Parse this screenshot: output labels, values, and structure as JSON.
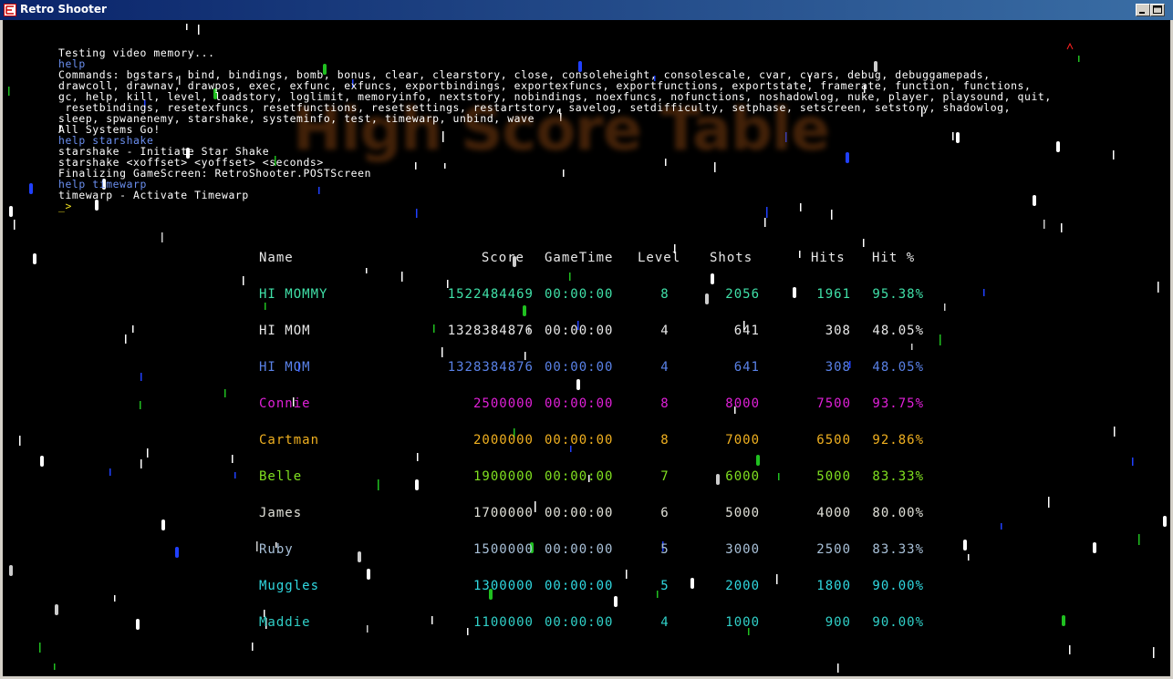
{
  "window": {
    "title": "Retro Shooter"
  },
  "background_title": "High Score Table",
  "console": {
    "lines": [
      {
        "text": "Testing video memory...",
        "kind": "out"
      },
      {
        "text": "help",
        "kind": "cmd"
      },
      {
        "text": "Commands: bgstars, bind, bindings, bomb, bonus, clear, clearstory, close, consoleheight, consolescale, cvar, cvars, debug, debuggamepads,",
        "kind": "out"
      },
      {
        "text": "drawcoll, drawnav, drawpos, exec, exfunc, exfuncs, exportbindings, exportexfuncs, exportfunctions, exportstate, framerate, function, functions,",
        "kind": "out"
      },
      {
        "text": "gc, help, kill, level, loadstory, loglimit, memoryinfo, nextstory, nobindings, noexfuncs, nofunctions, noshadowlog, nuke, player, playsound, quit,",
        "kind": "out"
      },
      {
        "text": " resetbindings, resetexfuncs, resetfunctions, resetsettings, restartstory, savelog, setdifficulty, setphase, setscreen, setstory, shadowlog,",
        "kind": "out"
      },
      {
        "text": "sleep, spwanenemy, starshake, systeminfo, test, timewarp, unbind, wave",
        "kind": "out"
      },
      {
        "text": "All Systems Go!",
        "kind": "out"
      },
      {
        "text": "help starshake",
        "kind": "cmd"
      },
      {
        "text": "starshake - Initiate Star Shake",
        "kind": "out"
      },
      {
        "text": "starshake <xoffset> <yoffset> <seconds>",
        "kind": "out"
      },
      {
        "text": "Finalizing GameScreen: RetroShooter.POSTScreen",
        "kind": "out"
      },
      {
        "text": "help timewarp",
        "kind": "cmd"
      },
      {
        "text": "timewarp - Activate Timewarp",
        "kind": "out"
      },
      {
        "text": "_>",
        "kind": "prompt"
      }
    ]
  },
  "table": {
    "headers": {
      "name": "Name",
      "score": "Score",
      "gametime": "GameTime",
      "level": "Level",
      "shots": "Shots",
      "hits": "Hits",
      "hitpct": "Hit %"
    },
    "rows": [
      {
        "name": "HI MOMMY",
        "score": "1522484469",
        "gametime": "00:00:00",
        "level": "8",
        "shots": "2056",
        "hits": "1961",
        "hitpct": "95.38%",
        "color": "#40e0a8"
      },
      {
        "name": "HI MOM",
        "score": "1328384876",
        "gametime": "00:00:00",
        "level": "4",
        "shots": "641",
        "hits": "308",
        "hitpct": "48.05%",
        "color": "#e8e8e8"
      },
      {
        "name": "HI MOM",
        "score": "1328384876",
        "gametime": "00:00:00",
        "level": "4",
        "shots": "641",
        "hits": "308",
        "hitpct": "48.05%",
        "color": "#5a82e8"
      },
      {
        "name": "Connie",
        "score": "2500000",
        "gametime": "00:00:00",
        "level": "8",
        "shots": "8000",
        "hits": "7500",
        "hitpct": "93.75%",
        "color": "#e020d8"
      },
      {
        "name": "Cartman",
        "score": "2000000",
        "gametime": "00:00:00",
        "level": "8",
        "shots": "7000",
        "hits": "6500",
        "hitpct": "92.86%",
        "color": "#f0b020"
      },
      {
        "name": "Belle",
        "score": "1900000",
        "gametime": "00:00:00",
        "level": "7",
        "shots": "6000",
        "hits": "5000",
        "hitpct": "83.33%",
        "color": "#80e020"
      },
      {
        "name": "James",
        "score": "1700000",
        "gametime": "00:00:00",
        "level": "6",
        "shots": "5000",
        "hits": "4000",
        "hitpct": "80.00%",
        "color": "#e0e0d8"
      },
      {
        "name": "Ruby",
        "score": "1500000",
        "gametime": "00:00:00",
        "level": "5",
        "shots": "3000",
        "hits": "2500",
        "hitpct": "83.33%",
        "color": "#a8c0d8"
      },
      {
        "name": "Muggles",
        "score": "1300000",
        "gametime": "00:00:00",
        "level": "5",
        "shots": "2000",
        "hits": "1800",
        "hitpct": "90.00%",
        "color": "#30d8e0"
      },
      {
        "name": "Maddie",
        "score": "1100000",
        "gametime": "00:00:00",
        "level": "4",
        "shots": "1000",
        "hits": "900",
        "hitpct": "90.00%",
        "color": "#30d0c8"
      }
    ]
  }
}
